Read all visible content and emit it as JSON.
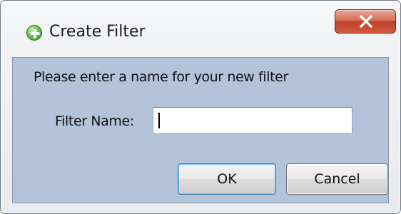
{
  "window": {
    "title": "Create Filter",
    "icon": "add-icon",
    "close_icon": "close-icon"
  },
  "dialog": {
    "prompt": "Please enter a name for your new filter",
    "filter_name_label": "Filter Name:",
    "filter_name_value": "",
    "ok_label": "OK",
    "cancel_label": "Cancel"
  },
  "colors": {
    "content_background": "#b3c3d9",
    "close_button": "#c2402a",
    "ok_border": "#3c7fb1"
  }
}
